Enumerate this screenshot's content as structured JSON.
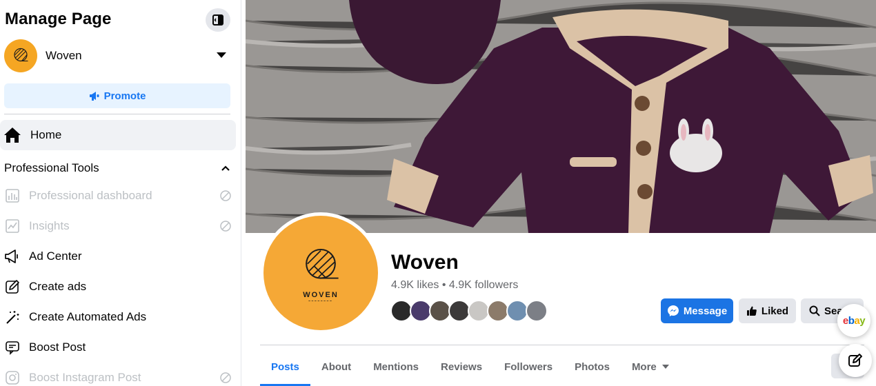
{
  "sidebar": {
    "title": "Manage Page",
    "page_name": "Woven",
    "promote_label": "Promote",
    "home_label": "Home",
    "section_label": "Professional Tools",
    "items": [
      {
        "label": "Professional dashboard",
        "icon": "dashboard-icon",
        "disabled": true
      },
      {
        "label": "Insights",
        "icon": "insights-icon",
        "disabled": true
      },
      {
        "label": "Ad Center",
        "icon": "megaphone-icon",
        "disabled": false
      },
      {
        "label": "Create ads",
        "icon": "pencil-icon",
        "disabled": false
      },
      {
        "label": "Create Automated Ads",
        "icon": "magic-wand-icon",
        "disabled": false
      },
      {
        "label": "Boost Post",
        "icon": "boost-post-icon",
        "disabled": false
      },
      {
        "label": "Boost Instagram Post",
        "icon": "instagram-icon",
        "disabled": true
      }
    ]
  },
  "page": {
    "name": "Woven",
    "stats": "4.9K likes • 4.9K followers",
    "logo_text": "WOVEN",
    "actions": {
      "message": "Message",
      "liked": "Liked",
      "search": "Search"
    },
    "tabs": [
      "Posts",
      "About",
      "Mentions",
      "Reviews",
      "Followers",
      "Photos",
      "More"
    ],
    "active_tab": "Posts"
  },
  "floating": {
    "ebay_label": "ebay"
  },
  "colors": {
    "accent": "#1877f2",
    "brand_orange": "#f5a836"
  }
}
